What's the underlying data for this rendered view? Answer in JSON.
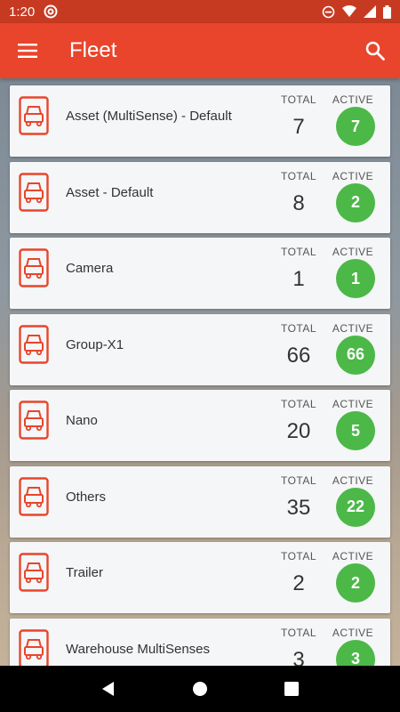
{
  "status_bar": {
    "time": "1:20",
    "icons": [
      "at-sign-icon",
      "dnd-icon",
      "wifi-icon",
      "signal-icon",
      "battery-icon"
    ]
  },
  "app_bar": {
    "title": "Fleet",
    "menu_icon": "hamburger-menu-icon",
    "search_icon": "search-icon"
  },
  "colors": {
    "app_bar": "#e8452c",
    "status_bar": "#c73a22",
    "active_badge": "#4cb848",
    "vehicle_icon": "#e8452c"
  },
  "groups": [
    {
      "name": "Asset (MultiSense) - Default",
      "total_label": "TOTAL",
      "active_label": "ACTIVE",
      "total": "7",
      "active": "7"
    },
    {
      "name": "Asset - Default",
      "total_label": "TOTAL",
      "active_label": "ACTIVE",
      "total": "8",
      "active": "2"
    },
    {
      "name": "Camera",
      "total_label": "TOTAL",
      "active_label": "ACTIVE",
      "total": "1",
      "active": "1"
    },
    {
      "name": "Group-X1",
      "total_label": "TOTAL",
      "active_label": "ACTIVE",
      "total": "66",
      "active": "66"
    },
    {
      "name": "Nano",
      "total_label": "TOTAL",
      "active_label": "ACTIVE",
      "total": "20",
      "active": "5"
    },
    {
      "name": "Others",
      "total_label": "TOTAL",
      "active_label": "ACTIVE",
      "total": "35",
      "active": "22"
    },
    {
      "name": "Trailer",
      "total_label": "TOTAL",
      "active_label": "ACTIVE",
      "total": "2",
      "active": "2"
    },
    {
      "name": "Warehouse MultiSenses",
      "total_label": "TOTAL",
      "active_label": "ACTIVE",
      "total": "3",
      "active": "3"
    }
  ],
  "nav_bar": {
    "buttons": [
      "back-icon",
      "home-icon",
      "recents-icon"
    ]
  }
}
